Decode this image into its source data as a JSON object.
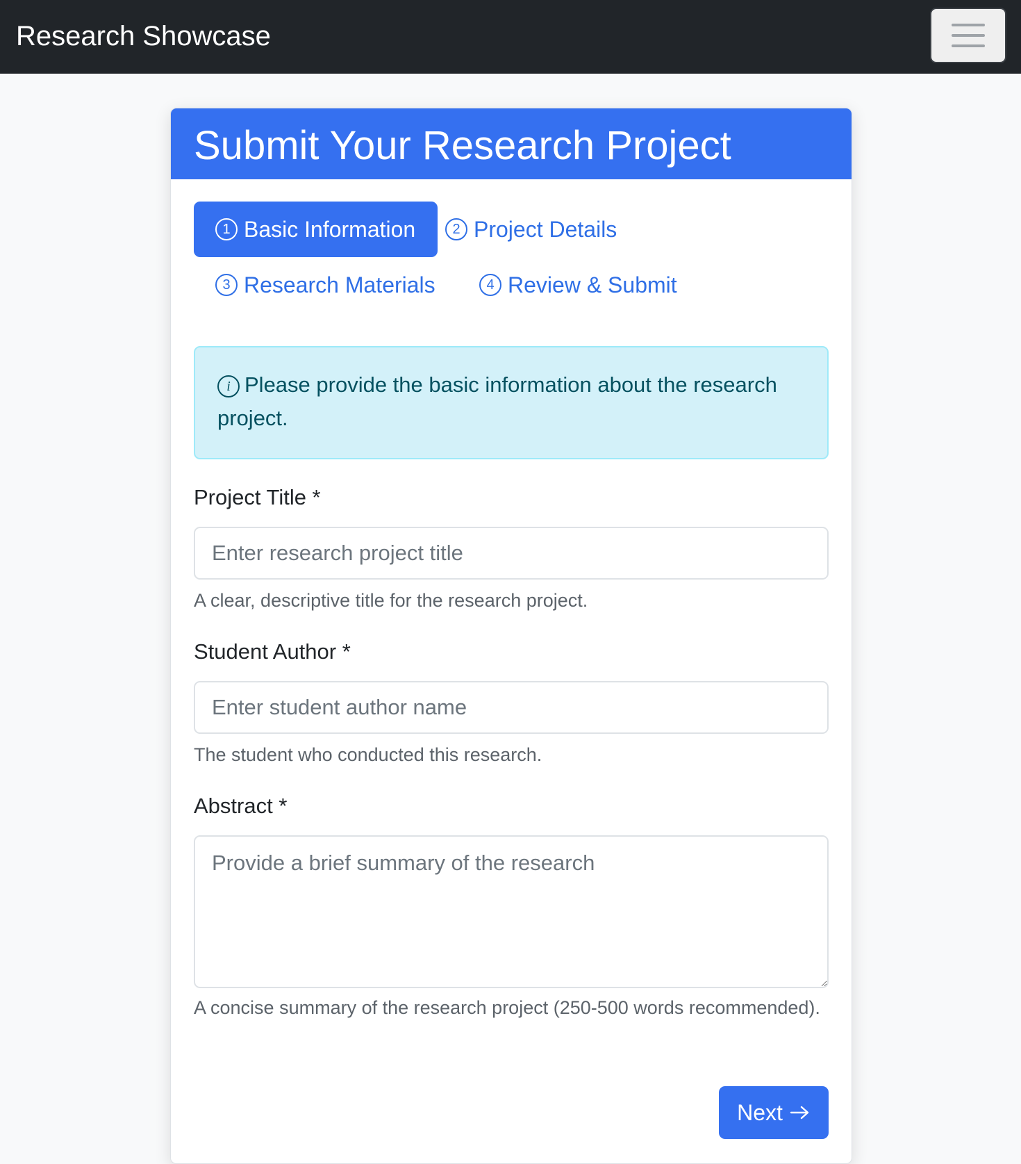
{
  "navbar": {
    "brand": "Research Showcase",
    "toggler_icon": "hamburger-menu-icon"
  },
  "form": {
    "title": "Submit Your Research Project",
    "steps": [
      {
        "number": "1",
        "label": "Basic Information",
        "active": true
      },
      {
        "number": "2",
        "label": "Project Details",
        "active": false
      },
      {
        "number": "3",
        "label": "Research Materials",
        "active": false
      },
      {
        "number": "4",
        "label": "Review & Submit",
        "active": false
      }
    ],
    "alert": {
      "icon": "info-icon",
      "text": "Please provide the basic information about the research project."
    },
    "fields": {
      "title": {
        "label": "Project Title *",
        "placeholder": "Enter research project title",
        "value": "",
        "help": "A clear, descriptive title for the research project."
      },
      "author": {
        "label": "Student Author *",
        "placeholder": "Enter student author name",
        "value": "",
        "help": "The student who conducted this research."
      },
      "abstract": {
        "label": "Abstract *",
        "placeholder": "Provide a brief summary of the research",
        "value": "",
        "help": "A concise summary of the research project (250-500 words recommended)."
      }
    },
    "next_label": "Next",
    "next_icon": "arrow-right-icon"
  },
  "colors": {
    "navbar_bg": "#212529",
    "primary": "#3570f0",
    "alert_bg": "#d3f1f9",
    "alert_text": "#055160",
    "page_bg": "#f8f9fa"
  }
}
